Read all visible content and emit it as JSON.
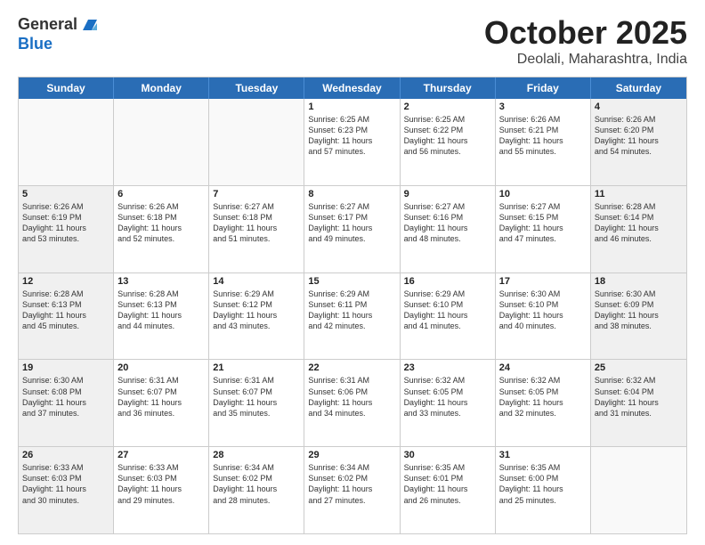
{
  "header": {
    "logo_line1": "General",
    "logo_line2": "Blue",
    "title": "October 2025",
    "location": "Deolali, Maharashtra, India"
  },
  "days_of_week": [
    "Sunday",
    "Monday",
    "Tuesday",
    "Wednesday",
    "Thursday",
    "Friday",
    "Saturday"
  ],
  "weeks": [
    [
      {
        "day": "",
        "info": "",
        "empty": true
      },
      {
        "day": "",
        "info": "",
        "empty": true
      },
      {
        "day": "",
        "info": "",
        "empty": true
      },
      {
        "day": "1",
        "info": "Sunrise: 6:25 AM\nSunset: 6:23 PM\nDaylight: 11 hours\nand 57 minutes.",
        "empty": false
      },
      {
        "day": "2",
        "info": "Sunrise: 6:25 AM\nSunset: 6:22 PM\nDaylight: 11 hours\nand 56 minutes.",
        "empty": false
      },
      {
        "day": "3",
        "info": "Sunrise: 6:26 AM\nSunset: 6:21 PM\nDaylight: 11 hours\nand 55 minutes.",
        "empty": false
      },
      {
        "day": "4",
        "info": "Sunrise: 6:26 AM\nSunset: 6:20 PM\nDaylight: 11 hours\nand 54 minutes.",
        "empty": false,
        "shaded": true
      }
    ],
    [
      {
        "day": "5",
        "info": "Sunrise: 6:26 AM\nSunset: 6:19 PM\nDaylight: 11 hours\nand 53 minutes.",
        "empty": false,
        "shaded": true
      },
      {
        "day": "6",
        "info": "Sunrise: 6:26 AM\nSunset: 6:18 PM\nDaylight: 11 hours\nand 52 minutes.",
        "empty": false
      },
      {
        "day": "7",
        "info": "Sunrise: 6:27 AM\nSunset: 6:18 PM\nDaylight: 11 hours\nand 51 minutes.",
        "empty": false
      },
      {
        "day": "8",
        "info": "Sunrise: 6:27 AM\nSunset: 6:17 PM\nDaylight: 11 hours\nand 49 minutes.",
        "empty": false
      },
      {
        "day": "9",
        "info": "Sunrise: 6:27 AM\nSunset: 6:16 PM\nDaylight: 11 hours\nand 48 minutes.",
        "empty": false
      },
      {
        "day": "10",
        "info": "Sunrise: 6:27 AM\nSunset: 6:15 PM\nDaylight: 11 hours\nand 47 minutes.",
        "empty": false
      },
      {
        "day": "11",
        "info": "Sunrise: 6:28 AM\nSunset: 6:14 PM\nDaylight: 11 hours\nand 46 minutes.",
        "empty": false,
        "shaded": true
      }
    ],
    [
      {
        "day": "12",
        "info": "Sunrise: 6:28 AM\nSunset: 6:13 PM\nDaylight: 11 hours\nand 45 minutes.",
        "empty": false,
        "shaded": true
      },
      {
        "day": "13",
        "info": "Sunrise: 6:28 AM\nSunset: 6:13 PM\nDaylight: 11 hours\nand 44 minutes.",
        "empty": false
      },
      {
        "day": "14",
        "info": "Sunrise: 6:29 AM\nSunset: 6:12 PM\nDaylight: 11 hours\nand 43 minutes.",
        "empty": false
      },
      {
        "day": "15",
        "info": "Sunrise: 6:29 AM\nSunset: 6:11 PM\nDaylight: 11 hours\nand 42 minutes.",
        "empty": false
      },
      {
        "day": "16",
        "info": "Sunrise: 6:29 AM\nSunset: 6:10 PM\nDaylight: 11 hours\nand 41 minutes.",
        "empty": false
      },
      {
        "day": "17",
        "info": "Sunrise: 6:30 AM\nSunset: 6:10 PM\nDaylight: 11 hours\nand 40 minutes.",
        "empty": false
      },
      {
        "day": "18",
        "info": "Sunrise: 6:30 AM\nSunset: 6:09 PM\nDaylight: 11 hours\nand 38 minutes.",
        "empty": false,
        "shaded": true
      }
    ],
    [
      {
        "day": "19",
        "info": "Sunrise: 6:30 AM\nSunset: 6:08 PM\nDaylight: 11 hours\nand 37 minutes.",
        "empty": false,
        "shaded": true
      },
      {
        "day": "20",
        "info": "Sunrise: 6:31 AM\nSunset: 6:07 PM\nDaylight: 11 hours\nand 36 minutes.",
        "empty": false
      },
      {
        "day": "21",
        "info": "Sunrise: 6:31 AM\nSunset: 6:07 PM\nDaylight: 11 hours\nand 35 minutes.",
        "empty": false
      },
      {
        "day": "22",
        "info": "Sunrise: 6:31 AM\nSunset: 6:06 PM\nDaylight: 11 hours\nand 34 minutes.",
        "empty": false
      },
      {
        "day": "23",
        "info": "Sunrise: 6:32 AM\nSunset: 6:05 PM\nDaylight: 11 hours\nand 33 minutes.",
        "empty": false
      },
      {
        "day": "24",
        "info": "Sunrise: 6:32 AM\nSunset: 6:05 PM\nDaylight: 11 hours\nand 32 minutes.",
        "empty": false
      },
      {
        "day": "25",
        "info": "Sunrise: 6:32 AM\nSunset: 6:04 PM\nDaylight: 11 hours\nand 31 minutes.",
        "empty": false,
        "shaded": true
      }
    ],
    [
      {
        "day": "26",
        "info": "Sunrise: 6:33 AM\nSunset: 6:03 PM\nDaylight: 11 hours\nand 30 minutes.",
        "empty": false,
        "shaded": true
      },
      {
        "day": "27",
        "info": "Sunrise: 6:33 AM\nSunset: 6:03 PM\nDaylight: 11 hours\nand 29 minutes.",
        "empty": false
      },
      {
        "day": "28",
        "info": "Sunrise: 6:34 AM\nSunset: 6:02 PM\nDaylight: 11 hours\nand 28 minutes.",
        "empty": false
      },
      {
        "day": "29",
        "info": "Sunrise: 6:34 AM\nSunset: 6:02 PM\nDaylight: 11 hours\nand 27 minutes.",
        "empty": false
      },
      {
        "day": "30",
        "info": "Sunrise: 6:35 AM\nSunset: 6:01 PM\nDaylight: 11 hours\nand 26 minutes.",
        "empty": false
      },
      {
        "day": "31",
        "info": "Sunrise: 6:35 AM\nSunset: 6:00 PM\nDaylight: 11 hours\nand 25 minutes.",
        "empty": false
      },
      {
        "day": "",
        "info": "",
        "empty": true,
        "shaded": false
      }
    ]
  ]
}
